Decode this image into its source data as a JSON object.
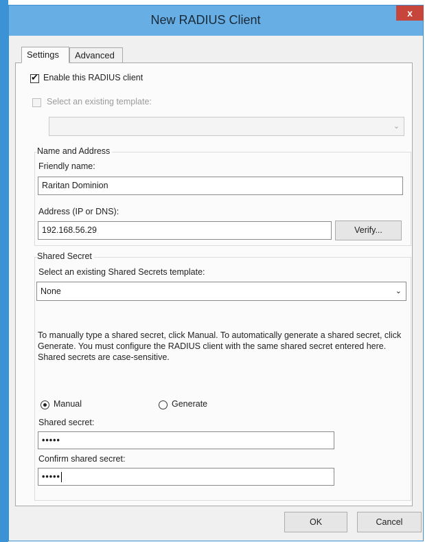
{
  "window": {
    "title": "New RADIUS Client",
    "close_label": "x"
  },
  "tabs": [
    {
      "label": "Settings"
    },
    {
      "label": "Advanced"
    }
  ],
  "settings": {
    "enable_client": {
      "label": "Enable this RADIUS client",
      "checked": true
    },
    "existing_template": {
      "label": "Select an existing template:",
      "checked": false,
      "value": ""
    },
    "name_address": {
      "heading": "Name and Address",
      "friendly_name_label": "Friendly name:",
      "friendly_name_value": "Raritan Dominion",
      "address_label": "Address (IP or DNS):",
      "address_value": "192.168.56.29",
      "verify_label": "Verify..."
    },
    "shared_secret": {
      "heading": "Shared Secret",
      "template_label": "Select an existing Shared Secrets template:",
      "template_value": "None",
      "description": "To manually type a shared secret, click Manual. To automatically generate a shared secret, click Generate. You must configure the RADIUS client with the same shared secret entered here. Shared secrets are case-sensitive.",
      "manual_label": "Manual",
      "generate_label": "Generate",
      "selected_mode": "Manual",
      "secret_label": "Shared secret:",
      "secret_value": "•••••",
      "confirm_label": "Confirm shared secret:",
      "confirm_value": "•••••"
    }
  },
  "footer": {
    "ok_label": "OK",
    "cancel_label": "Cancel"
  }
}
